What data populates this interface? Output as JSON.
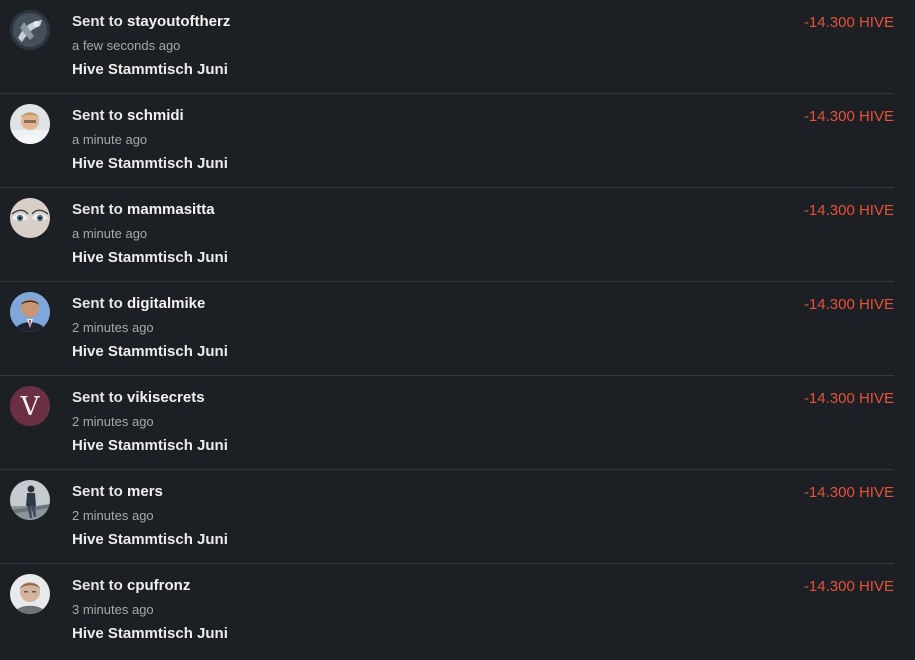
{
  "transfers": [
    {
      "prefix": "Sent to",
      "user": "stayoutoftherz",
      "time": "a few seconds ago",
      "memo": "Hive Stammtisch Juni",
      "amount": "-14.300 HIVE",
      "avatar": "stayoutoftherz-avatar"
    },
    {
      "prefix": "Sent to",
      "user": "schmidi",
      "time": "a minute ago",
      "memo": "Hive Stammtisch Juni",
      "amount": "-14.300 HIVE",
      "avatar": "schmidi-avatar"
    },
    {
      "prefix": "Sent to",
      "user": "mammasitta",
      "time": "a minute ago",
      "memo": "Hive Stammtisch Juni",
      "amount": "-14.300 HIVE",
      "avatar": "mammasitta-avatar"
    },
    {
      "prefix": "Sent to",
      "user": "digitalmike",
      "time": "2 minutes ago",
      "memo": "Hive Stammtisch Juni",
      "amount": "-14.300 HIVE",
      "avatar": "digitalmike-avatar"
    },
    {
      "prefix": "Sent to",
      "user": "vikisecrets",
      "time": "2 minutes ago",
      "memo": "Hive Stammtisch Juni",
      "amount": "-14.300 HIVE",
      "avatar": "vikisecrets-avatar",
      "avatar_letter": "V"
    },
    {
      "prefix": "Sent to",
      "user": "mers",
      "time": "2 minutes ago",
      "memo": "Hive Stammtisch Juni",
      "amount": "-14.300 HIVE",
      "avatar": "mers-avatar"
    },
    {
      "prefix": "Sent to",
      "user": "cpufronz",
      "time": "3 minutes ago",
      "memo": "Hive Stammtisch Juni",
      "amount": "-14.300 HIVE",
      "avatar": "cpufronz-avatar"
    }
  ],
  "colors": {
    "background": "#1c1f23",
    "amount": "#e8513a",
    "divider": "#34373c",
    "muted": "#a6a8ab"
  }
}
